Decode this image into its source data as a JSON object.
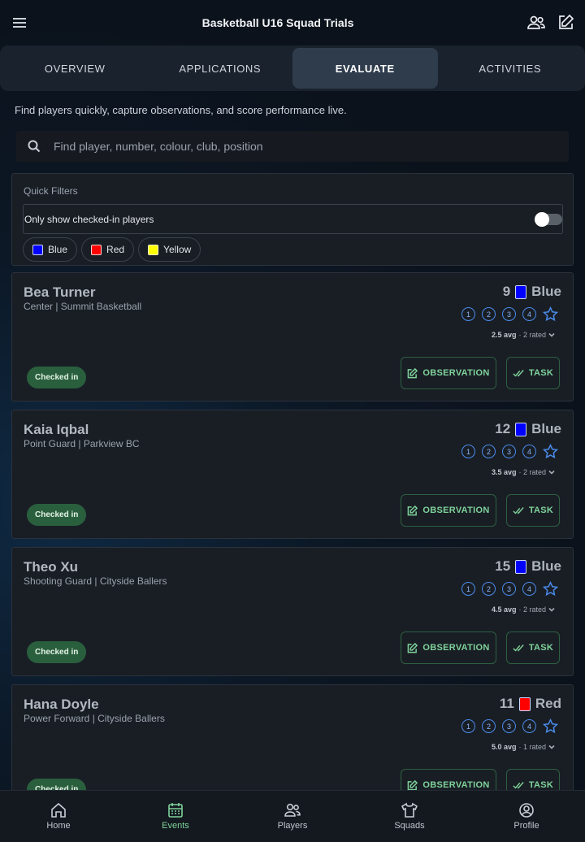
{
  "header": {
    "title": "Basketball U16 Squad Trials"
  },
  "tabs": [
    {
      "label": "OVERVIEW",
      "active": false
    },
    {
      "label": "APPLICATIONS",
      "active": false
    },
    {
      "label": "EVALUATE",
      "active": true
    },
    {
      "label": "ACTIVITIES",
      "active": false
    }
  ],
  "description": "Find players quickly, capture observations, and score performance live.",
  "search": {
    "placeholder": "Find player, number, colour, club, position"
  },
  "filters": {
    "label": "Quick Filters",
    "toggle_label": "Only show checked-in players",
    "toggle_on": false,
    "chips": [
      {
        "label": "Blue",
        "color": "#0000ff"
      },
      {
        "label": "Red",
        "color": "#ff0000"
      },
      {
        "label": "Yellow",
        "color": "#ffff00"
      }
    ]
  },
  "rating_values": [
    "1",
    "2",
    "3",
    "4"
  ],
  "actions": {
    "observation": "OBSERVATION",
    "task": "TASK"
  },
  "players": [
    {
      "name": "Bea Turner",
      "info": "Center | Summit Basketball",
      "number": "9",
      "team": "Blue",
      "team_color": "#0000ff",
      "avg": "2.5 avg",
      "rated": "· 2 rated",
      "status": "Checked in"
    },
    {
      "name": "Kaia Iqbal",
      "info": "Point Guard | Parkview BC",
      "number": "12",
      "team": "Blue",
      "team_color": "#0000ff",
      "avg": "3.5 avg",
      "rated": "· 2 rated",
      "status": "Checked in"
    },
    {
      "name": "Theo Xu",
      "info": "Shooting Guard | Cityside Ballers",
      "number": "15",
      "team": "Blue",
      "team_color": "#0000ff",
      "avg": "4.5 avg",
      "rated": "· 2 rated",
      "status": "Checked in"
    },
    {
      "name": "Hana Doyle",
      "info": "Power Forward | Cityside Ballers",
      "number": "11",
      "team": "Red",
      "team_color": "#ff0000",
      "avg": "5.0 avg",
      "rated": "· 1 rated",
      "status": "Checked in"
    }
  ],
  "bottom_nav": [
    {
      "label": "Home",
      "icon": "home-icon",
      "active": false
    },
    {
      "label": "Events",
      "icon": "calendar-icon",
      "active": true
    },
    {
      "label": "Players",
      "icon": "users-icon",
      "active": false
    },
    {
      "label": "Squads",
      "icon": "shirt-icon",
      "active": false
    },
    {
      "label": "Profile",
      "icon": "profile-icon",
      "active": false
    }
  ]
}
